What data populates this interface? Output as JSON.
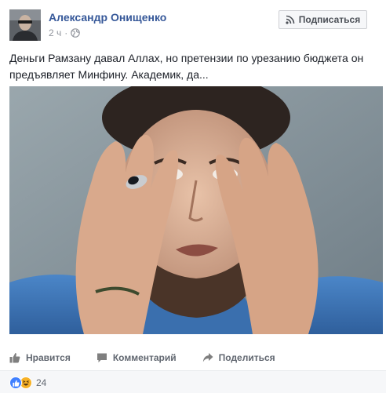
{
  "post": {
    "author": "Александр Онищенко",
    "time": "2 ч",
    "separator": "·",
    "follow_label": "Подписаться",
    "text": "Деньги Рамзану давал Аллах, но претензии по урезанию бюджета он предъявляет Минфину. Академик, да...",
    "actions": {
      "like": "Нравится",
      "comment": "Комментарий",
      "share": "Поделиться"
    },
    "reactions": {
      "count": "24",
      "types": [
        "like-icon",
        "haha-icon"
      ]
    },
    "colors": {
      "author_link": "#365899",
      "meta_gray": "#90949c",
      "action_gray": "#616770",
      "like_blue": "#4080ff",
      "haha_yellow": "#f7b125"
    }
  }
}
